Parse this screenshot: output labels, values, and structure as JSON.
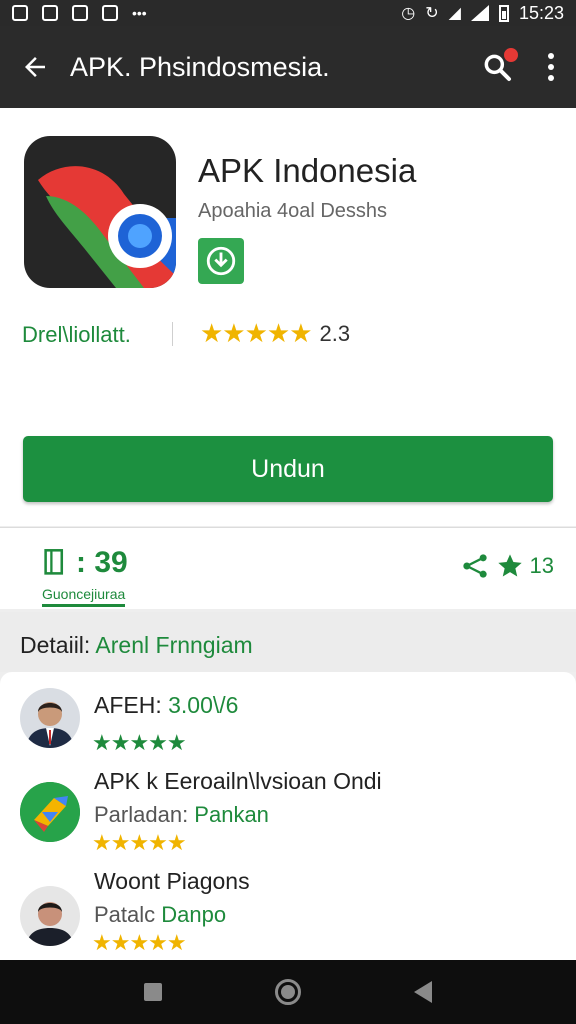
{
  "status_bar": {
    "time": "15:23",
    "icons": [
      "notification-icon",
      "bookmark-icon",
      "calendar-icon",
      "photo-icon",
      "overflow-icon",
      "alarm-icon",
      "sync-icon",
      "wifi-icon",
      "signal-icon",
      "battery-icon"
    ]
  },
  "app_bar": {
    "title": "APK. Phsindosmesia.",
    "back_icon": "arrow-left-icon",
    "search_icon": "search-icon",
    "menu_icon": "more-vert-icon"
  },
  "app": {
    "name": "APK Indonesia",
    "subtitle": "Apoahia 4oal Desshs",
    "developer": "Drel\\liollatt.",
    "rating_stars": "★★★★★",
    "rating_count": "2.3",
    "icon_name": "app-logo-icon",
    "download_label": "Undun"
  },
  "stats": {
    "downloads": ": 39",
    "downloads_label": "Guoncejiuraa",
    "share_count": "13"
  },
  "details": {
    "label": "Detaiil:",
    "value": " Arenl Frnngiam"
  },
  "list": [
    {
      "title_label": "AFEH:",
      "title_value": " 3.00\\/6",
      "stars": "★★★★★",
      "avatar": "man-in-suit-avatar"
    },
    {
      "title": "APK k Eeroailn\\lvsioan Ondi",
      "sub_label": "Parladan:",
      "sub_value": " Pankan",
      "stars": "★★★★★",
      "avatar": "app-logo-avatar"
    },
    {
      "title": "Woont Piagons",
      "sub_label": "Patalc",
      "sub_value": " Danpo",
      "stars": "★★★★★",
      "avatar": "man-avatar"
    }
  ],
  "colors": {
    "accent_green": "#1e8a3c",
    "button_green": "#1c9040",
    "star_gold": "#f0b400",
    "app_bar": "#2b2b2b"
  }
}
